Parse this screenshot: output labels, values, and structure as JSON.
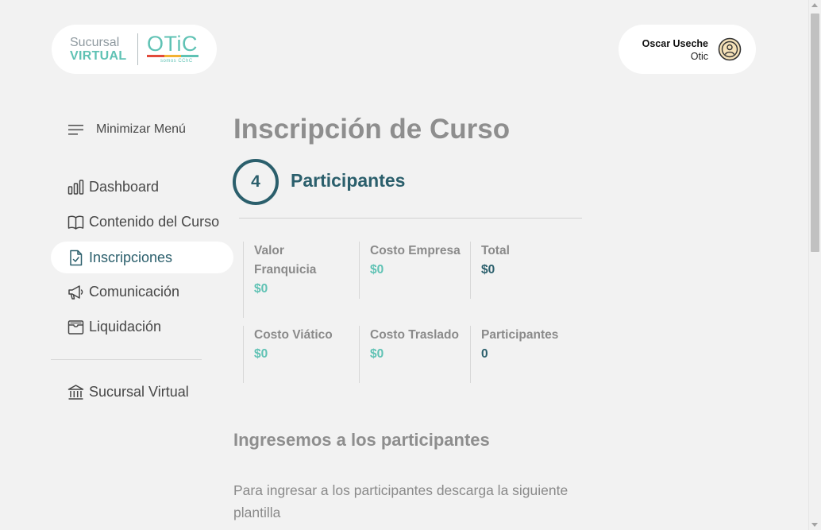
{
  "logo": {
    "line1": "Sucursal",
    "line2": "VIRTUAL",
    "brand": "OTiC",
    "tagline": "somos CChC",
    "bar_colors": [
      "#e24a3b",
      "#f2b233",
      "#5fc2b4"
    ]
  },
  "user": {
    "name": "Oscar Useche",
    "org": "Otic",
    "avatar_icon": "user-circle-icon"
  },
  "menu": {
    "minimize_label": "Minimizar Menú",
    "minimize_icon": "hamburger-icon",
    "items": [
      {
        "label": "Dashboard",
        "icon": "bar-chart-icon",
        "active": false
      },
      {
        "label": "Contenido del Curso",
        "icon": "open-book-icon",
        "active": false
      },
      {
        "label": "Inscripciones",
        "icon": "document-check-icon",
        "active": true
      },
      {
        "label": "Comunicación",
        "icon": "megaphone-icon",
        "active": false
      },
      {
        "label": "Liquidación",
        "icon": "wallet-icon",
        "active": false
      }
    ],
    "footer_item": {
      "label": "Sucursal Virtual",
      "icon": "bank-building-icon"
    }
  },
  "page": {
    "title": "Inscripción de Curso",
    "step": {
      "number": "4",
      "title": "Participantes"
    }
  },
  "stats": [
    {
      "label": "Valor Franquicia",
      "value": "$0",
      "tone": "teal"
    },
    {
      "label": "Costo Empresa",
      "value": "$0",
      "tone": "teal"
    },
    {
      "label": "Total",
      "value": "$0",
      "tone": "dark"
    },
    {
      "label": "Costo Viático",
      "value": "$0",
      "tone": "teal"
    },
    {
      "label": "Costo Traslado",
      "value": "$0",
      "tone": "teal"
    },
    {
      "label": "Participantes",
      "value": "0",
      "tone": "dark"
    }
  ],
  "section": {
    "title": "Ingresemos a los participantes",
    "description": "Para ingresar a los participantes descarga la siguiente plantilla"
  },
  "colors": {
    "accent_teal": "#5fc2b4",
    "dark_teal": "#2b5f6c",
    "background": "#f2f2f2"
  }
}
